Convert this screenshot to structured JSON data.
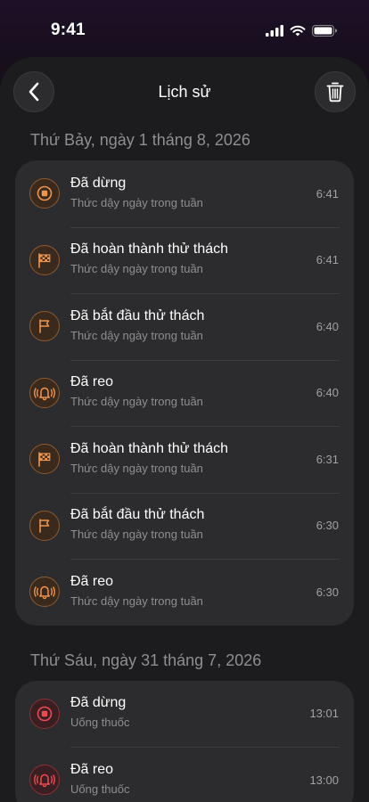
{
  "status_bar": {
    "time": "9:41"
  },
  "header": {
    "title": "Lịch sử",
    "back_icon": "chevron-left-icon",
    "trash_icon": "trash-icon"
  },
  "colors": {
    "accent_orange": "#f0954a",
    "accent_red": "#ee4a52"
  },
  "sections": [
    {
      "date": "Thứ Bảy, ngày 1 tháng 8, 2026",
      "items": [
        {
          "icon": "stop-icon",
          "title": "Đã dừng",
          "subtitle": "Thức dậy ngày trong tuần",
          "time": "6:41"
        },
        {
          "icon": "checkered-flag-icon",
          "title": "Đã hoàn thành thử thách",
          "subtitle": "Thức dậy ngày trong tuần",
          "time": "6:41"
        },
        {
          "icon": "flag-icon",
          "title": "Đã bắt đầu thử thách",
          "subtitle": "Thức dậy ngày trong tuần",
          "time": "6:40"
        },
        {
          "icon": "ringing-bell-icon",
          "title": "Đã reo",
          "subtitle": "Thức dậy ngày trong tuần",
          "time": "6:40"
        },
        {
          "icon": "checkered-flag-icon",
          "title": "Đã hoàn thành thử thách",
          "subtitle": "Thức dậy ngày trong tuần",
          "time": "6:31"
        },
        {
          "icon": "flag-icon",
          "title": "Đã bắt đầu thử thách",
          "subtitle": "Thức dậy ngày trong tuần",
          "time": "6:30"
        },
        {
          "icon": "ringing-bell-icon",
          "title": "Đã reo",
          "subtitle": "Thức dậy ngày trong tuần",
          "time": "6:30"
        }
      ]
    },
    {
      "date": "Thứ Sáu, ngày 31 tháng 7, 2026",
      "items": [
        {
          "icon": "stop-icon",
          "title": "Đã dừng",
          "subtitle": "Uống thuốc",
          "time": "13:01"
        },
        {
          "icon": "ringing-bell-icon",
          "title": "Đã reo",
          "subtitle": "Uống thuốc",
          "time": "13:00"
        }
      ]
    }
  ]
}
